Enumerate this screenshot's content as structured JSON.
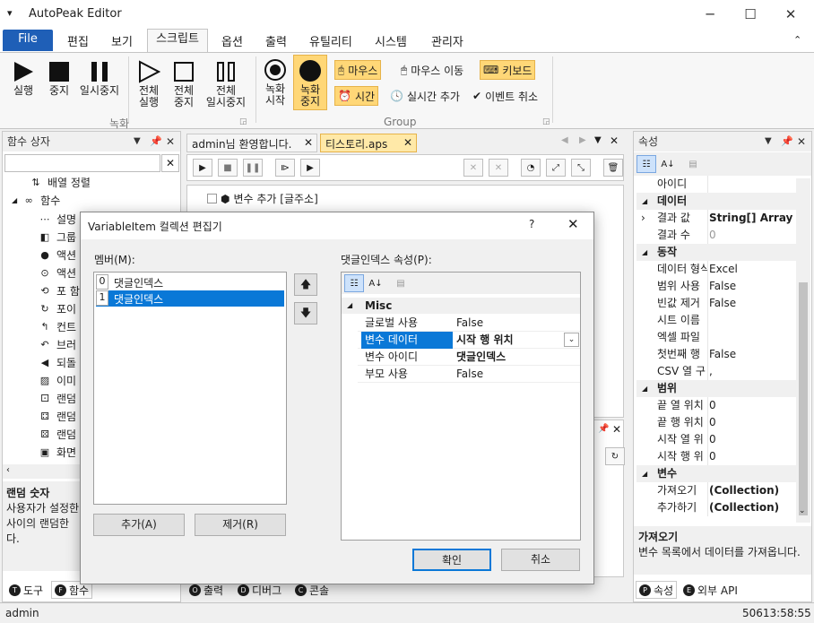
{
  "app": {
    "title": "AutoPeak Editor"
  },
  "menu": {
    "file": "File",
    "items": [
      "편집",
      "보기",
      "스크립트",
      "옵션",
      "출력",
      "유틸리티",
      "시스템",
      "관리자"
    ]
  },
  "ribbon": {
    "run": "실행",
    "stop": "중지",
    "pause": "일시중지",
    "all_run": [
      "전체",
      "실행"
    ],
    "all_stop": [
      "전체",
      "중지"
    ],
    "all_pause": [
      "전체",
      "일시중지"
    ],
    "group_record": "녹화",
    "rec_start": [
      "녹화",
      "시작"
    ],
    "rec_stop": [
      "녹화",
      "중지"
    ],
    "mouse": "마우스",
    "mouse_move": "마우스 이동",
    "keyboard": "키보드",
    "time": "시간",
    "realtime_add": "실시간 추가",
    "event_cancel": "이벤트 취소",
    "group_label": "Group"
  },
  "left_panel": {
    "title": "함수 상자",
    "tree": [
      "배열 정렬",
      "함수",
      "설명",
      "그룹",
      "액션",
      "액션",
      "포 함",
      "포이",
      "컨트",
      "브러",
      "되돌",
      "이미",
      "랜덤",
      "랜덤",
      "랜덤",
      "화면"
    ],
    "desc_title": "랜덤 숫자",
    "desc_text": [
      "사용자가 설정한",
      "사이의 랜덤한",
      "다."
    ],
    "tabs": [
      "도구",
      "함수"
    ]
  },
  "doc_tabs": [
    "admin님 환영합니다.",
    "티스토리.aps"
  ],
  "script_row": "변수 추가 [글주소]",
  "bottom_tabs": [
    "출력",
    "디버그",
    "콘솔"
  ],
  "props": {
    "title": "속성",
    "rows": [
      {
        "type": "row",
        "name": "아이디",
        "value": ""
      },
      {
        "type": "cat",
        "name": "데이터"
      },
      {
        "type": "row",
        "name": "결과 값",
        "value": "String[] Array",
        "bold": true,
        "expand": true
      },
      {
        "type": "row",
        "name": "결과 수",
        "value": "0",
        "grey": true
      },
      {
        "type": "cat",
        "name": "동작"
      },
      {
        "type": "row",
        "name": "데이터 형식",
        "value": "Excel"
      },
      {
        "type": "row",
        "name": "범위 사용",
        "value": "False"
      },
      {
        "type": "row",
        "name": "빈값 제거",
        "value": "False"
      },
      {
        "type": "row",
        "name": "시트 이름",
        "value": ""
      },
      {
        "type": "row",
        "name": "엑셀 파일",
        "value": ""
      },
      {
        "type": "row",
        "name": "첫번째 행",
        "value": "False"
      },
      {
        "type": "row",
        "name": "CSV 열 구",
        "value": ","
      },
      {
        "type": "cat",
        "name": "범위"
      },
      {
        "type": "row",
        "name": "끝 열 위치",
        "value": "0"
      },
      {
        "type": "row",
        "name": "끝 행 위치",
        "value": "0"
      },
      {
        "type": "row",
        "name": "시작 열 위",
        "value": "0"
      },
      {
        "type": "row",
        "name": "시작 행 위",
        "value": "0"
      },
      {
        "type": "cat",
        "name": "변수"
      },
      {
        "type": "row",
        "name": "가져오기",
        "value": "(Collection)",
        "bold": true
      },
      {
        "type": "row",
        "name": "추가하기",
        "value": "(Collection)",
        "bold": true
      }
    ],
    "desc_title": "가져오기",
    "desc_text": "변수 목록에서 데이터를 가져옵니다.",
    "tabs": [
      "속성",
      "외부 API"
    ]
  },
  "status": {
    "user": "admin",
    "time": "50613:58:55"
  },
  "dialog": {
    "title": "VariableItem 컬렉션 편집기",
    "help": "?",
    "members_label": "멤버(M):",
    "members": [
      {
        "index": "0",
        "name": "댓글인덱스"
      },
      {
        "index": "1",
        "name": "댓글인덱스"
      }
    ],
    "props_label": "댓글인덱스 속성(P):",
    "category": "Misc",
    "props": [
      {
        "name": "글로벌 사용",
        "value": "False"
      },
      {
        "name": "변수 데이터",
        "value": "시작 행 위치",
        "bold": true,
        "selected": true
      },
      {
        "name": "변수 아이디",
        "value": "댓글인덱스",
        "bold": true
      },
      {
        "name": "부모 사용",
        "value": "False"
      }
    ],
    "add": "추가(A)",
    "remove": "제거(R)",
    "ok": "확인",
    "cancel": "취소"
  }
}
